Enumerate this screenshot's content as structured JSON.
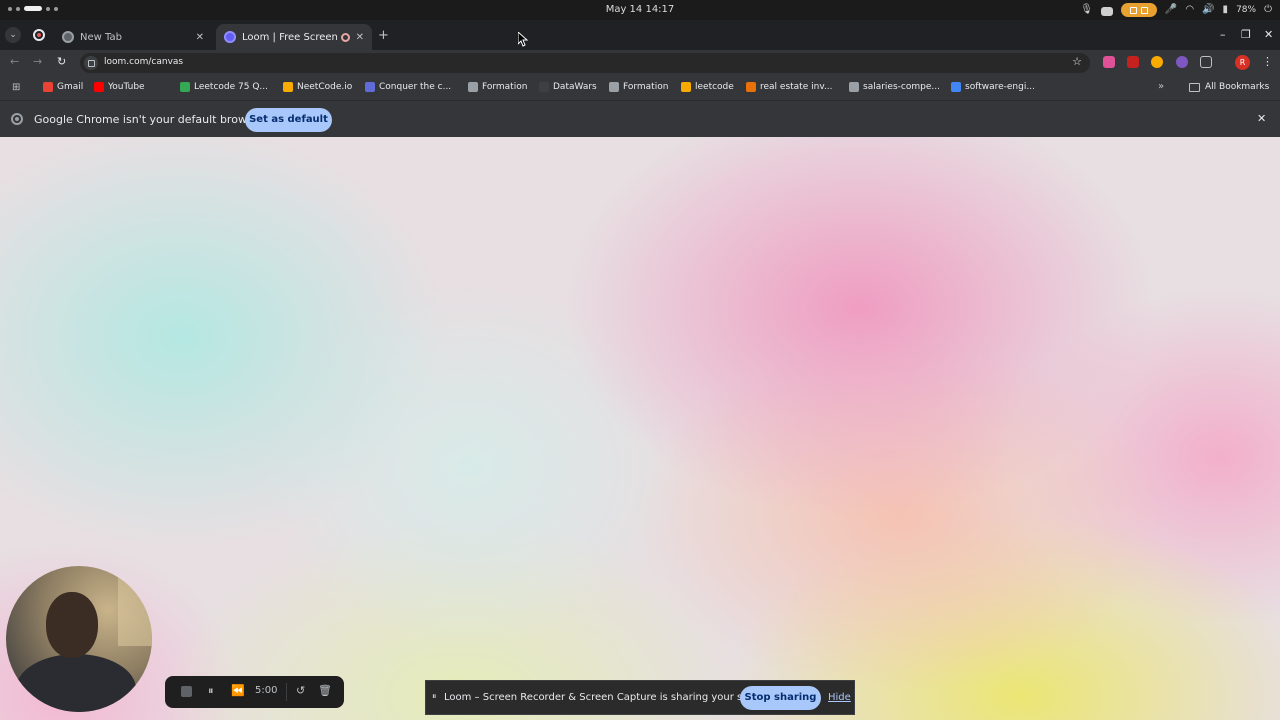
{
  "os_bar": {
    "clock": "May 14  14:17",
    "battery": "78%"
  },
  "tabs": [
    {
      "title": "New Tab",
      "close": "✕"
    },
    {
      "title": "Loom | Free Screen & Video Recording Software",
      "close": "✕"
    }
  ],
  "tab_strip": {
    "new_tab": "+",
    "minimize": "–",
    "restore": "❐",
    "close": "✕"
  },
  "toolbar": {
    "back": "←",
    "forward": "→",
    "reload": "↻",
    "url": "loom.com/canvas",
    "star": "☆",
    "profile_initial": "R",
    "menu": "⋮"
  },
  "bookmarks": {
    "apps_icon": "apps-grid-icon",
    "items": [
      {
        "label": "Gmail",
        "color": "#ea4335"
      },
      {
        "label": "YouTube",
        "color": "#ff0000"
      },
      {
        "label": "Leetcode 75 Q...",
        "color": "#34a853"
      },
      {
        "label": "NeetCode.io",
        "color": "#f9ab00"
      },
      {
        "label": "Conquer the c...",
        "color": "#5f6bd8"
      },
      {
        "label": "Formation",
        "color": "#9aa0a6"
      },
      {
        "label": "DataWars",
        "color": "#3c4043"
      },
      {
        "label": "Formation",
        "color": "#9aa0a6"
      },
      {
        "label": "leetcode",
        "color": "#f9ab00"
      },
      {
        "label": "real estate inv...",
        "color": "#e8710a"
      },
      {
        "label": "salaries-compe...",
        "color": "#9aa0a6"
      },
      {
        "label": "software-engi...",
        "color": "#4285f4"
      }
    ],
    "overflow": "»",
    "all_bookmarks": "All Bookmarks"
  },
  "infobar": {
    "message": "Google Chrome isn't your default browser",
    "button": "Set as default",
    "close": "✕"
  },
  "recorder": {
    "timer": "5:00",
    "pause": "⏸",
    "rewind": "⏪",
    "restart": "↺",
    "delete": "🗑"
  },
  "share_bar": {
    "pause_glyph": "⏸",
    "message": "Loom – Screen Recorder & Screen Capture is sharing your screen.",
    "stop_button": "Stop sharing",
    "hide_link": "Hide"
  }
}
